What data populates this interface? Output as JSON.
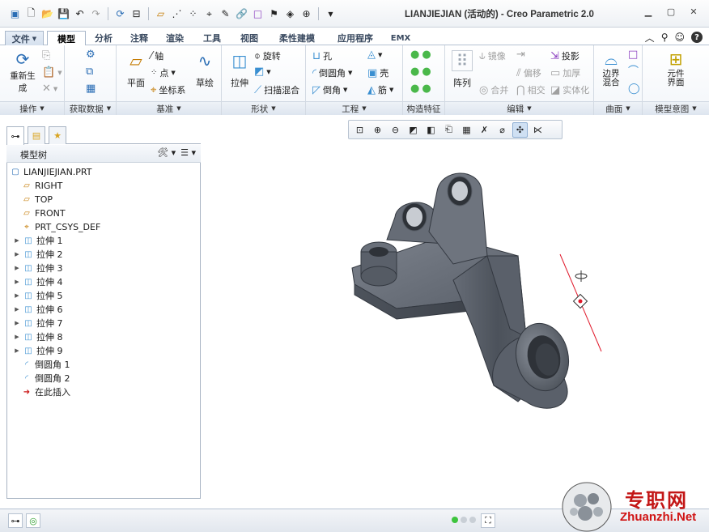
{
  "window": {
    "title": "LIANJIEJIAN (活动的) - Creo Parametric 2.0"
  },
  "tabs": [
    "文件",
    "模型",
    "分析",
    "注释",
    "渲染",
    "工具",
    "视图",
    "柔性建模",
    "应用程序",
    "EMX"
  ],
  "ribbon": {
    "operations": {
      "title": "操作",
      "regenerate": "重新生成"
    },
    "get_data": {
      "title": "获取数据"
    },
    "datum": {
      "title": "基准",
      "plane": "平面",
      "axis": "轴",
      "point": "点",
      "csys": "坐标系",
      "sketch": "草绘"
    },
    "shapes": {
      "title": "形状",
      "extrude": "拉伸",
      "revolve": "旋转",
      "sweep_blend": "扫描混合"
    },
    "engineering": {
      "title": "工程",
      "hole": "孔",
      "round": "倒圆角",
      "chamfer": "倒角",
      "shell": "壳",
      "rib": "筋"
    },
    "construct": {
      "title": "构造特征"
    },
    "editing": {
      "title": "编辑",
      "pattern": "阵列",
      "mirror": "镜像",
      "merge": "合并",
      "offset": "偏移",
      "intersect": "相交",
      "project": "投影",
      "thicken": "加厚",
      "solidify": "实体化"
    },
    "surfaces": {
      "title": "曲面",
      "boundary_blend": "边界混合"
    },
    "model_intent": {
      "title": "模型意图",
      "component_interface": "元件界面"
    }
  },
  "model_tree": {
    "title": "模型树",
    "items": [
      {
        "label": "LIANJIEJIAN.PRT",
        "icon": "part-icon",
        "expandable": false
      },
      {
        "label": "RIGHT",
        "icon": "datum-plane-icon",
        "expandable": false
      },
      {
        "label": "TOP",
        "icon": "datum-plane-icon",
        "expandable": false
      },
      {
        "label": "FRONT",
        "icon": "datum-plane-icon",
        "expandable": false
      },
      {
        "label": "PRT_CSYS_DEF",
        "icon": "csys-icon",
        "expandable": false
      },
      {
        "label": "拉伸 1",
        "icon": "extrude-icon",
        "expandable": true
      },
      {
        "label": "拉伸 2",
        "icon": "extrude-icon",
        "expandable": true
      },
      {
        "label": "拉伸 3",
        "icon": "extrude-icon",
        "expandable": true
      },
      {
        "label": "拉伸 4",
        "icon": "extrude-icon",
        "expandable": true
      },
      {
        "label": "拉伸 5",
        "icon": "extrude-icon",
        "expandable": true
      },
      {
        "label": "拉伸 6",
        "icon": "extrude-icon",
        "expandable": true
      },
      {
        "label": "拉伸 7",
        "icon": "extrude-icon",
        "expandable": true
      },
      {
        "label": "拉伸 8",
        "icon": "extrude-icon",
        "expandable": true
      },
      {
        "label": "拉伸 9",
        "icon": "extrude-icon",
        "expandable": true
      },
      {
        "label": "倒圆角 1",
        "icon": "round-icon",
        "expandable": false
      },
      {
        "label": "倒圆角 2",
        "icon": "round-icon",
        "expandable": false
      },
      {
        "label": "在此插入",
        "icon": "insert-here-icon",
        "expandable": false
      }
    ]
  },
  "watermark": {
    "line1": "专职网",
    "line2": "Zhuanzhi.Net"
  },
  "colors": {
    "accent": "#2a6db5",
    "part_body": "#5d6470",
    "datum_axis": "#e0182a"
  }
}
